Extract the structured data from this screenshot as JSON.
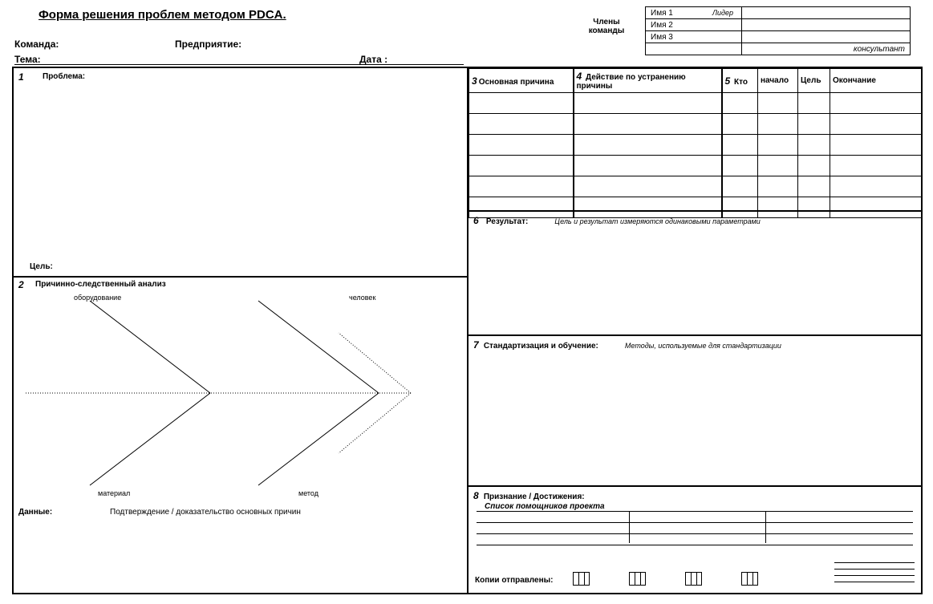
{
  "header": {
    "title": "Форма решения проблем методом PDCA.",
    "team_label": "Команда:",
    "enterprise_label": "Предприятие:",
    "topic_label": "Тема:",
    "date_label": "Дата :",
    "members_label": "Члены команды"
  },
  "members": {
    "rows": [
      {
        "name": "Имя 1",
        "role": "Лидер"
      },
      {
        "name": "Имя 2",
        "role": ""
      },
      {
        "name": "Имя 3",
        "role": ""
      }
    ],
    "consultant_role": "консультант"
  },
  "section1": {
    "num": "1",
    "label": "Проблема:",
    "goal_label": "Цель:"
  },
  "section2": {
    "num": "2",
    "label": "Причинно-следственный анализ",
    "data_label": "Данные:",
    "data_confirm": "Подтверждение / доказательство основных причин",
    "fishbone": {
      "equipment": "оборудование",
      "person": "человек",
      "material": "материал",
      "method": "метод"
    }
  },
  "action_table": {
    "col3": {
      "num": "3",
      "label": "Основная причина"
    },
    "col4": {
      "num": "4",
      "label": "Действие по устранению причины"
    },
    "col5": {
      "num": "5",
      "label_who": "Кто",
      "label_start": "начало",
      "label_goal": "Цель",
      "label_end": "Окончание"
    }
  },
  "section6": {
    "num": "6",
    "label": "Результат:",
    "hint": "Цель и результат измеряются  одинаковыми параметрами"
  },
  "section7": {
    "num": "7",
    "label": "Стандартизация и обучение:",
    "hint": "Методы, используемые для стандартизации"
  },
  "section8": {
    "num": "8",
    "label": "Признание / Достижения:",
    "sublabel": "Список помощников проекта",
    "copies_label": "Копии отправлены:"
  }
}
